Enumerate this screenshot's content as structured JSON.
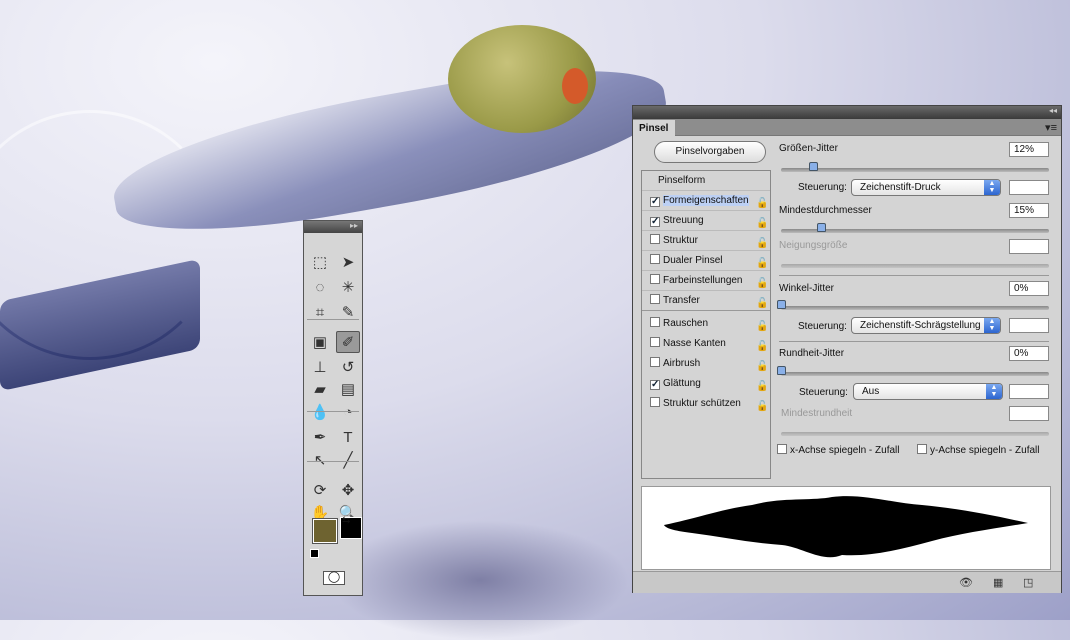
{
  "toolbox": {
    "tools": [
      {
        "name": "rectangular-marquee-icon",
        "glyph": "⬚"
      },
      {
        "name": "move-icon",
        "glyph": "➤"
      },
      {
        "name": "lasso-icon",
        "glyph": "◌"
      },
      {
        "name": "magic-wand-icon",
        "glyph": "✳"
      },
      {
        "name": "crop-icon",
        "glyph": "⌗"
      },
      {
        "name": "eyedropper-icon",
        "glyph": "✎"
      },
      {
        "name": "healing-brush-icon",
        "glyph": "▣"
      },
      {
        "name": "brush-icon",
        "glyph": "✐"
      },
      {
        "name": "clone-stamp-icon",
        "glyph": "⊥"
      },
      {
        "name": "history-brush-icon",
        "glyph": "↺"
      },
      {
        "name": "eraser-icon",
        "glyph": "▰"
      },
      {
        "name": "gradient-icon",
        "glyph": "▤"
      },
      {
        "name": "blur-icon",
        "glyph": "💧"
      },
      {
        "name": "dodge-icon",
        "glyph": "◔"
      },
      {
        "name": "pen-icon",
        "glyph": "✒"
      },
      {
        "name": "type-icon",
        "glyph": "T"
      },
      {
        "name": "path-selection-icon",
        "glyph": "↖"
      },
      {
        "name": "line-icon",
        "glyph": "╱"
      },
      {
        "name": "3d-rotate-icon",
        "glyph": "⟳"
      },
      {
        "name": "3d-pan-icon",
        "glyph": "✥"
      },
      {
        "name": "hand-icon",
        "glyph": "✋"
      },
      {
        "name": "zoom-icon",
        "glyph": "🔍"
      }
    ],
    "foreground_color": "#6e6330",
    "background_color": "#000000"
  },
  "panel": {
    "tab": "Pinsel",
    "preset_button": "Pinselvorgaben",
    "list_header": "Pinselform",
    "items": [
      {
        "label": "Formeigenschaften",
        "checked": true
      },
      {
        "label": "Streuung",
        "checked": true
      },
      {
        "label": "Struktur",
        "checked": false
      },
      {
        "label": "Dualer Pinsel",
        "checked": false
      },
      {
        "label": "Farbeinstellungen",
        "checked": false
      },
      {
        "label": "Transfer",
        "checked": false
      },
      {
        "label": "Rauschen",
        "checked": false
      },
      {
        "label": "Nasse Kanten",
        "checked": false
      },
      {
        "label": "Airbrush",
        "checked": false
      },
      {
        "label": "Glättung",
        "checked": true
      },
      {
        "label": "Struktur schützen",
        "checked": false
      }
    ],
    "size_jitter": {
      "label": "Größen-Jitter",
      "value": "12%",
      "percent": 12
    },
    "control_label": "Steuerung:",
    "size_control": "Zeichenstift-Druck",
    "min_diameter": {
      "label": "Mindestdurchmesser",
      "value": "15%",
      "percent": 15
    },
    "tilt_scale": {
      "label": "Neigungsgröße"
    },
    "angle_jitter": {
      "label": "Winkel-Jitter",
      "value": "0%",
      "percent": 0
    },
    "angle_control": "Zeichenstift-Schrägstellung",
    "roundness_jitter": {
      "label": "Rundheit-Jitter",
      "value": "0%",
      "percent": 0
    },
    "roundness_control": "Aus",
    "min_roundness": {
      "label": "Mindestrundheit"
    },
    "flip_x": "x-Achse spiegeln - Zufall",
    "flip_y": "y-Achse spiegeln - Zufall"
  }
}
